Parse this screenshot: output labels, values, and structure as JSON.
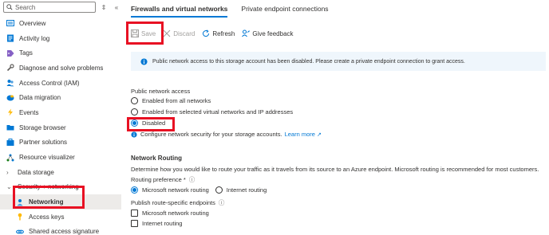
{
  "sidebar": {
    "search_placeholder": "Search",
    "collapse_label": "«",
    "sort_label": "⇕",
    "items": [
      {
        "label": "Overview",
        "icon": "overview-icon"
      },
      {
        "label": "Activity log",
        "icon": "activity-log-icon"
      },
      {
        "label": "Tags",
        "icon": "tag-icon"
      },
      {
        "label": "Diagnose and solve problems",
        "icon": "wrench-icon"
      },
      {
        "label": "Access Control (IAM)",
        "icon": "people-icon"
      },
      {
        "label": "Data migration",
        "icon": "data-migration-icon"
      },
      {
        "label": "Events",
        "icon": "lightning-icon"
      },
      {
        "label": "Storage browser",
        "icon": "folder-icon"
      },
      {
        "label": "Partner solutions",
        "icon": "partner-icon"
      },
      {
        "label": "Resource visualizer",
        "icon": "visualizer-icon"
      },
      {
        "label": "Data storage",
        "icon": "chevron-right-icon"
      },
      {
        "label": "Security + networking",
        "icon": "chevron-down-icon"
      },
      {
        "label": "Networking",
        "icon": "networking-icon"
      },
      {
        "label": "Access keys",
        "icon": "key-icon"
      },
      {
        "label": "Shared access signature",
        "icon": "link-icon"
      }
    ]
  },
  "tabs": [
    {
      "label": "Firewalls and virtual networks"
    },
    {
      "label": "Private endpoint connections"
    }
  ],
  "toolbar": {
    "save_label": "Save",
    "discard_label": "Discard",
    "refresh_label": "Refresh",
    "feedback_label": "Give feedback"
  },
  "banner": {
    "text": "Public network access to this storage account has been disabled. Please create a private endpoint connection to grant access."
  },
  "public_access": {
    "label": "Public network access",
    "options": [
      "Enabled from all networks",
      "Enabled from selected virtual networks and IP addresses",
      "Disabled"
    ],
    "selected": "Disabled",
    "hint": "Configure network security for your storage accounts.",
    "learn_more": "Learn more"
  },
  "routing": {
    "heading": "Network Routing",
    "description": "Determine how you would like to route your traffic as it travels from its source to an Azure endpoint. Microsoft routing is recommended for most customers.",
    "preference_label": "Routing preference *",
    "preference_options": [
      "Microsoft network routing",
      "Internet routing"
    ],
    "preference_selected": "Microsoft network routing",
    "publish_label": "Publish route-specific endpoints",
    "publish_options": [
      "Microsoft network routing",
      "Internet routing"
    ]
  },
  "colors": {
    "accent": "#0078d4",
    "highlight": "#e81123",
    "banner_bg": "#eff6fc"
  }
}
